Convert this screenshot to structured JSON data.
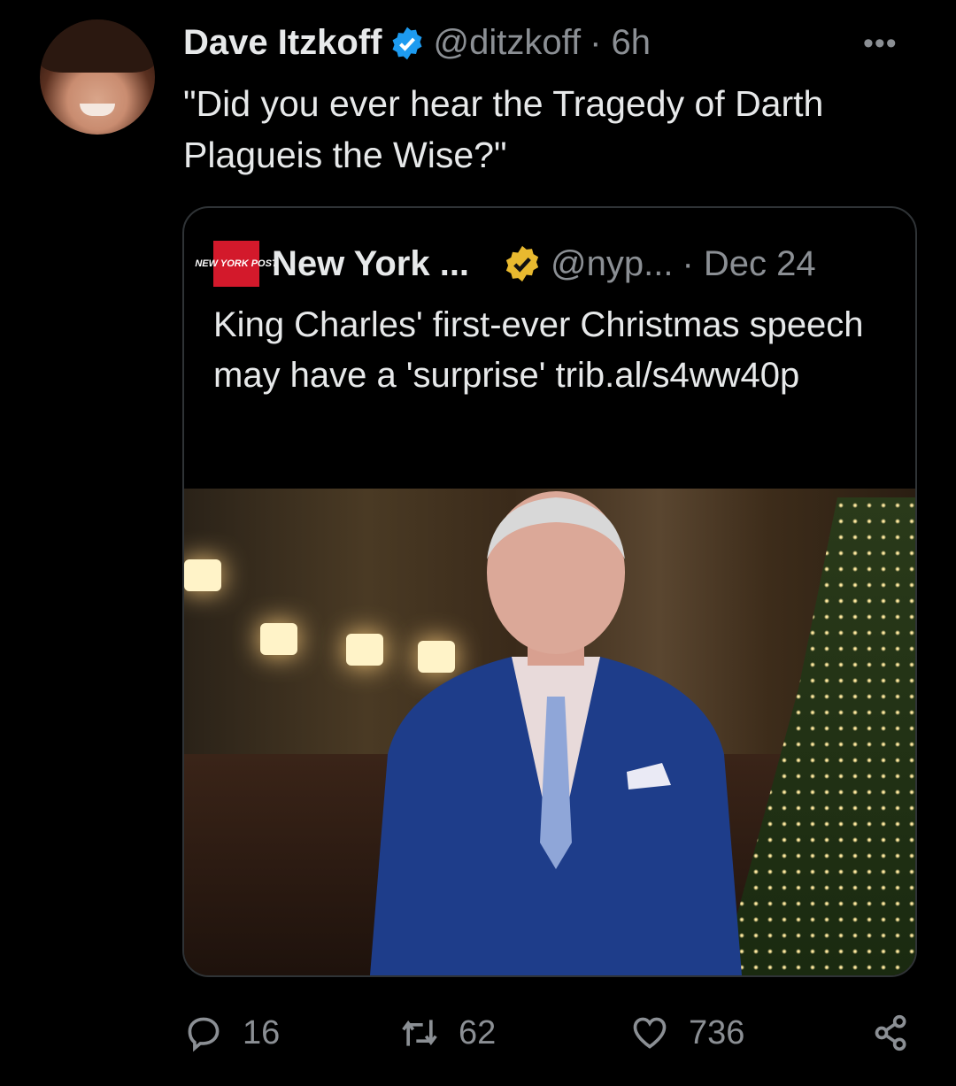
{
  "tweet": {
    "author_name": "Dave Itzkoff",
    "handle": "@ditzkoff",
    "time": "· 6h",
    "text": "\"Did you ever hear the Tragedy of Darth Plagueis the Wise?\"",
    "more_icon": "•••"
  },
  "quoted": {
    "logo_text": "NEW YORK POST",
    "author_name": "New York ...",
    "handle": "@nyp...",
    "time": "· Dec 24",
    "text": "King Charles' first-ever Christmas speech may have a 'surprise' trib.al/s4ww40p"
  },
  "actions": {
    "replies": "16",
    "retweets": "62",
    "likes": "736"
  },
  "colors": {
    "verified_blue": "#1d9bf0",
    "verified_gold": "#e8b92f",
    "nyp_red": "#d3192b"
  }
}
